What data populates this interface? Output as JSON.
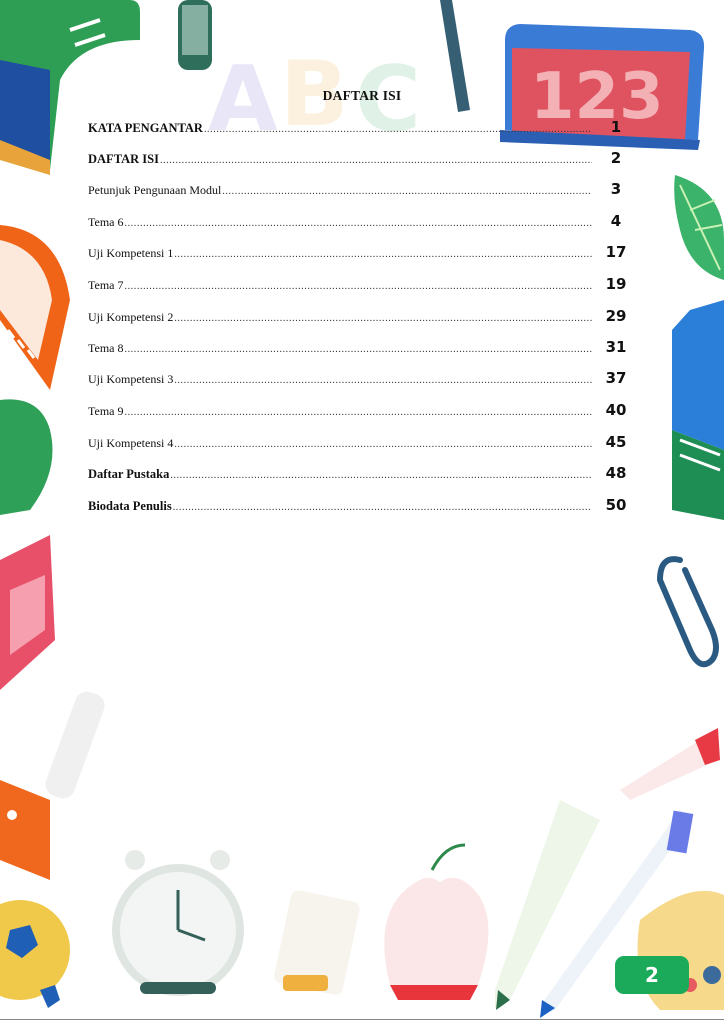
{
  "toc": {
    "title": "DAFTAR ISI",
    "entries": [
      {
        "label": "KATA PENGANTAR",
        "page": "1",
        "bold": true
      },
      {
        "label": "DAFTAR ISI",
        "page": "2",
        "bold": true
      },
      {
        "label": "Petunjuk Pengunaan Modul",
        "page": "3",
        "bold": false
      },
      {
        "label": "Tema 6",
        "page": "4",
        "bold": false
      },
      {
        "label": "Uji Kompetensi 1",
        "page": "17",
        "bold": false
      },
      {
        "label": "Tema 7",
        "page": "19",
        "bold": false
      },
      {
        "label": "Uji Kompetensi 2",
        "page": "29",
        "bold": false
      },
      {
        "label": "Tema 8",
        "page": "31",
        "bold": false
      },
      {
        "label": "Uji Kompetensi 3",
        "page": "37",
        "bold": false
      },
      {
        "label": "Tema 9",
        "page": "40",
        "bold": false
      },
      {
        "label": "Uji Kompetensi 4",
        "page": "45",
        "bold": false
      },
      {
        "label": "Daftar Pustaka",
        "page": "48",
        "bold": true
      },
      {
        "label": "Biodata Penulis",
        "page": "50",
        "bold": true
      }
    ]
  },
  "footer": {
    "page_number": "2",
    "badge_color": "#1aaa5a"
  },
  "decorations": {
    "top_left": "green-notebook-icon",
    "top_center": "abc-letters-icon",
    "top_right": "red-123-board-icon",
    "left_side": "ruler-icon",
    "right_side": "leaf-icon",
    "right_middle": "book-icon",
    "right_clip": "paperclip-icon",
    "bottom_center": "alarm-clock-icon",
    "bottom_apple": "apple-icon",
    "bottom_right": "paint-palette-icon",
    "bottom_left": "soccer-ball-icon"
  }
}
